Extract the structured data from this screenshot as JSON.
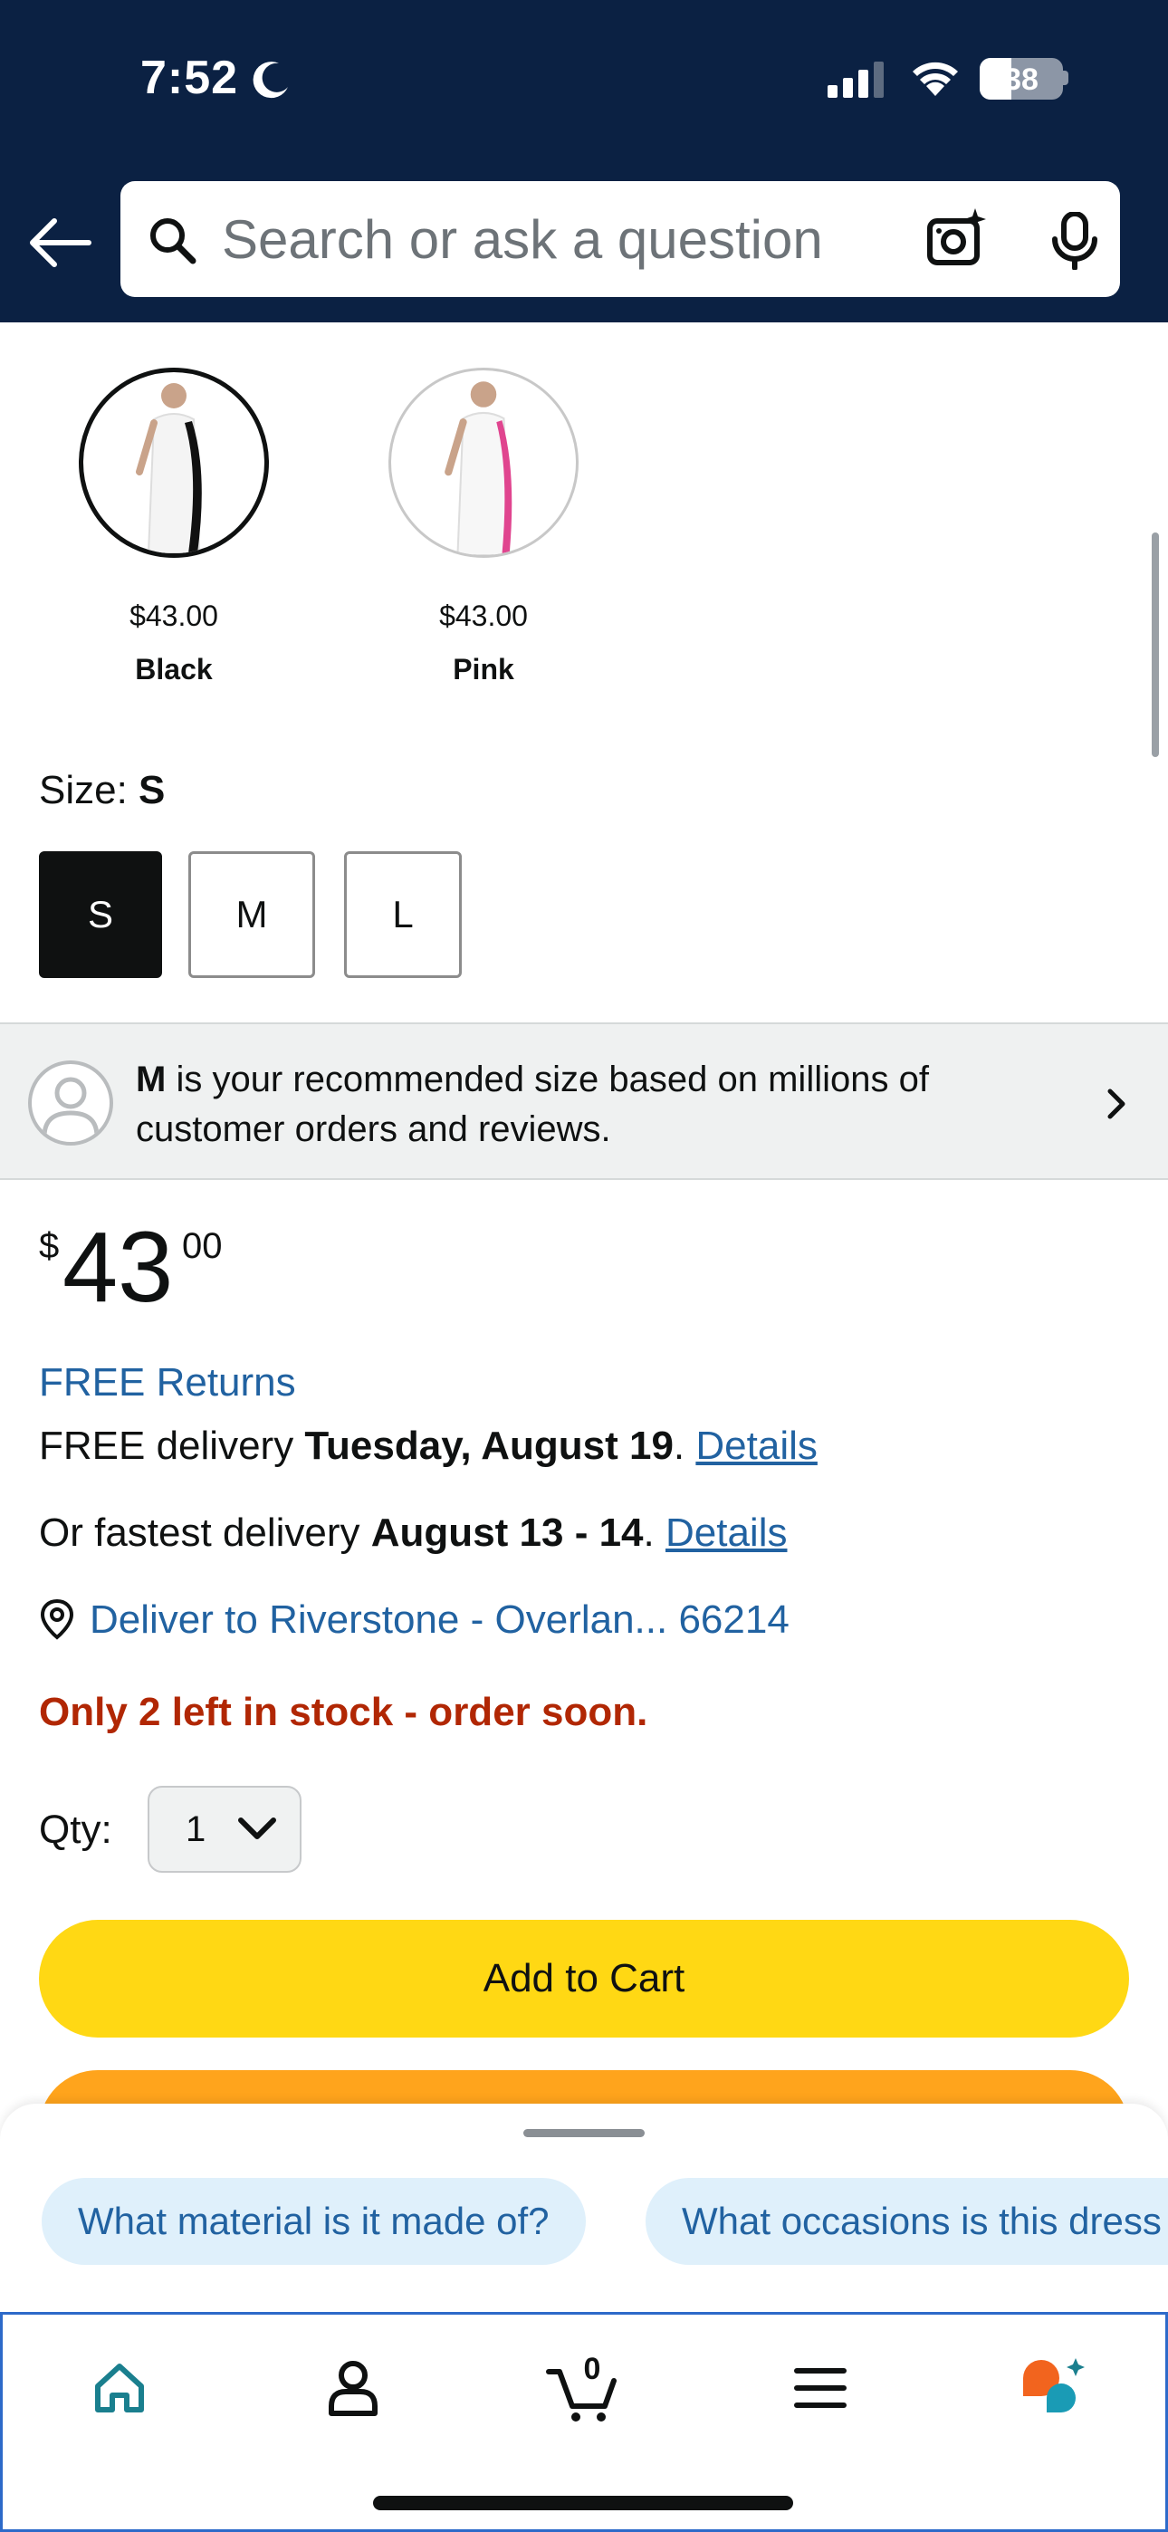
{
  "status_bar": {
    "time": "7:52",
    "battery": "38"
  },
  "header": {
    "search_placeholder": "Search or ask a question"
  },
  "color_options": [
    {
      "price": "$43.00",
      "name": "Black",
      "selected": true
    },
    {
      "price": "$43.00",
      "name": "Pink",
      "selected": false
    }
  ],
  "size": {
    "label": "Size: ",
    "selected": "S",
    "options": [
      "S",
      "M",
      "L"
    ]
  },
  "recommendation": {
    "size": "M",
    "text": " is your recommended size based on millions of customer orders and reviews."
  },
  "price": {
    "currency": "$",
    "whole": "43",
    "fraction": "00"
  },
  "delivery": {
    "free_returns": "FREE Returns",
    "standard_prefix": "FREE delivery ",
    "standard_date": "Tuesday, August 19",
    "standard_suffix": ". ",
    "fastest_prefix": "Or fastest delivery ",
    "fastest_date": "August 13 - 14",
    "fastest_suffix": ". ",
    "details_link": "Details",
    "deliver_to": "Deliver to Riverstone - Overlan... 66214"
  },
  "stock": "Only 2 left in stock - order soon.",
  "quantity": {
    "label": "Qty:",
    "value": "1"
  },
  "buttons": {
    "add_to_cart": "Add to Cart"
  },
  "suggestions": [
    "What material is it made of?",
    "What occasions is this dress suitable for?"
  ],
  "tabbar": {
    "cart_count": "0",
    "items": [
      "home-icon",
      "account-icon",
      "cart-icon",
      "menu-icon",
      "rufus-icon"
    ]
  },
  "colors": {
    "header_bg": "#0b2143",
    "link": "#2162a1",
    "stock_red": "#b12704",
    "add_to_cart": "#ffd814",
    "buy_now": "#ffa41c",
    "home_active": "#1a7f8e"
  }
}
